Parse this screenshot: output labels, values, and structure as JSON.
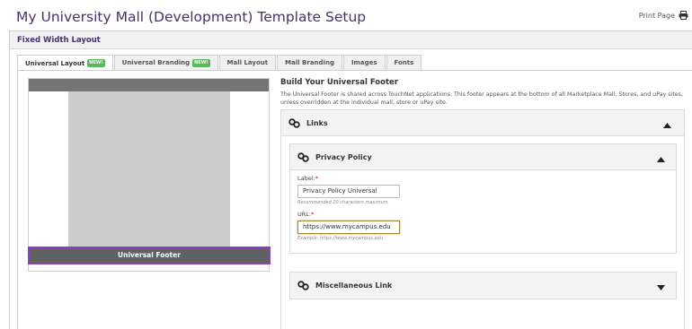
{
  "header": {
    "title": "My University Mall (Development) Template Setup",
    "print_label": "Print Page",
    "print_icon": "printer-icon"
  },
  "section": {
    "title": "Fixed Width Layout"
  },
  "tabs": [
    {
      "label": "Universal Layout",
      "badge": "NEW!",
      "active": true
    },
    {
      "label": "Universal Branding",
      "badge": "NEW!",
      "active": false
    },
    {
      "label": "Mall Layout",
      "badge": "",
      "active": false
    },
    {
      "label": "Mall Branding",
      "badge": "",
      "active": false
    },
    {
      "label": "Images",
      "badge": "",
      "active": false
    },
    {
      "label": "Fonts",
      "badge": "",
      "active": false
    }
  ],
  "preview": {
    "footer_label": "Universal Footer"
  },
  "form": {
    "title": "Build Your Universal Footer",
    "description": "The Universal Footer is shared across TouchNet applications. This footer appears at the bottom of all Marketplace Mall, Stores, and uPay sites, unless overridden at the individual mall, store or uPay site.",
    "links_panel": {
      "label": "Links",
      "icon": "link-icon",
      "state": "expanded"
    },
    "privacy_policy": {
      "label": "Privacy Policy",
      "icon": "link-icon",
      "state": "expanded",
      "label_field": {
        "label": "Label:",
        "required_mark": "*",
        "value": "Privacy Policy Universal",
        "hint": "Recommended 20 characters maximum"
      },
      "url_field": {
        "label": "URL:",
        "required_mark": "*",
        "value": "https://www.mycampus.edu",
        "hint": "Example: https://www.mycampus.edu"
      }
    },
    "misc_link": {
      "label": "Miscellaneous Link",
      "icon": "link-icon",
      "state": "collapsed"
    }
  },
  "colors": {
    "title": "#4a2f6e",
    "badge": "#5cb85c",
    "footer_highlight": "#8a3fc4",
    "required": "#cc0000"
  }
}
